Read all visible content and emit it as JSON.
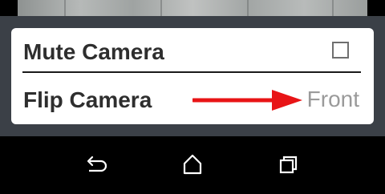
{
  "menu": {
    "items": [
      {
        "label": "Mute Camera",
        "checked": false
      },
      {
        "label": "Flip Camera",
        "value": "Front"
      }
    ]
  },
  "annotation": {
    "arrow_color": "#e81416"
  },
  "nav": {
    "back_icon": "back-icon",
    "home_icon": "home-icon",
    "recents_icon": "recents-icon"
  }
}
